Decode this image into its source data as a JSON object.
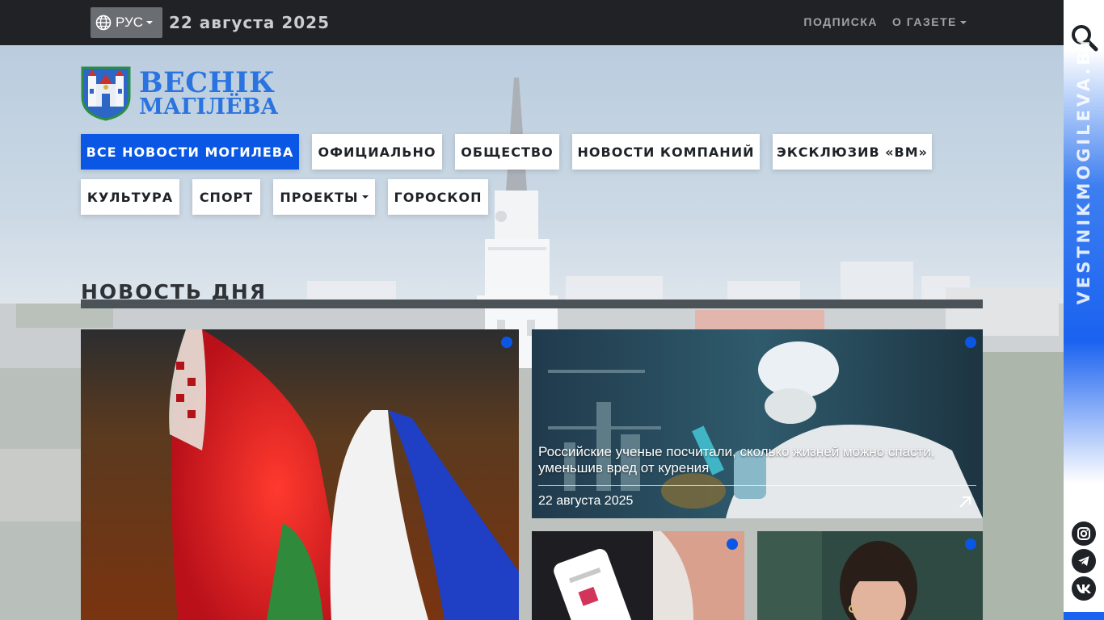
{
  "topbar": {
    "language": "РУС",
    "date": "22 августа 2025",
    "links": [
      {
        "label": "ПОДПИСКА",
        "has_dropdown": false
      },
      {
        "label": "О ГАЗЕТЕ",
        "has_dropdown": true
      }
    ]
  },
  "logo": {
    "line1": "ВЕСНІК",
    "line2": "МАГІЛЁВА"
  },
  "nav": [
    {
      "label": "ВСЕ НОВОСТИ МОГИЛЕВА",
      "active": true
    },
    {
      "label": "ОФИЦИАЛЬНО"
    },
    {
      "label": "ОБЩЕСТВО"
    },
    {
      "label": "НОВОСТИ КОМПАНИЙ"
    },
    {
      "label": "ЭКСКЛЮЗИВ «ВМ»"
    },
    {
      "label": "КУЛЬТУРА"
    },
    {
      "label": "СПОРТ"
    },
    {
      "label": "ПРОЕКТЫ",
      "has_dropdown": true
    },
    {
      "label": "ГОРОСКОП"
    }
  ],
  "section": {
    "title": "НОВОСТЬ ДНЯ"
  },
  "cards": [
    {
      "id": "flags"
    },
    {
      "id": "scientist",
      "title": "Российские ученые посчитали, сколько жизней можно спасти, уменьшив вред от курения",
      "date": "22 августа 2025"
    },
    {
      "id": "phone"
    },
    {
      "id": "woman"
    }
  ],
  "sidebar": {
    "vertical_text": "VESTNIKMOGILEVA.BY",
    "icons": [
      "search-icon",
      "instagram-icon",
      "telegram-icon",
      "vk-icon"
    ]
  },
  "colors": {
    "accent": "#0a57e5",
    "topbar": "#202226",
    "logo": "#2b74e0"
  }
}
